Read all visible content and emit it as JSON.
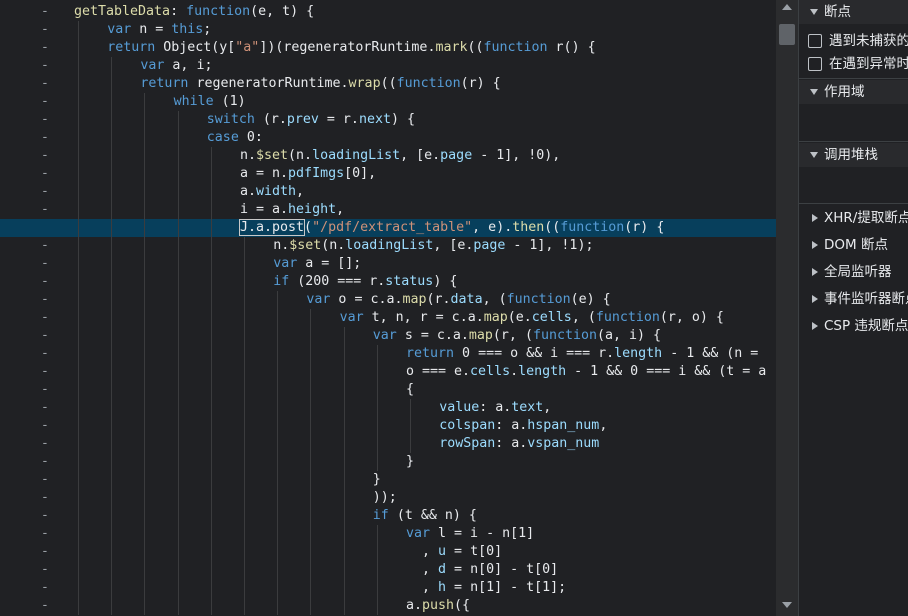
{
  "colors": {
    "background": "#202124",
    "keyword": "#569cd6",
    "function": "#dcdcaa",
    "property": "#9cdcfe",
    "string": "#ce9178",
    "number": "#b5cea8",
    "highlight_line": "#073f5c"
  },
  "editor": {
    "gutter_mark": "-",
    "highlight_index": 12,
    "lines": [
      {
        "indent": 0,
        "tokens": [
          [
            "fn",
            "getTableData"
          ],
          [
            "plain",
            ": "
          ],
          [
            "kw",
            "function"
          ],
          [
            "plain",
            "(e, t) {"
          ]
        ]
      },
      {
        "indent": 1,
        "tokens": [
          [
            "kw",
            "var"
          ],
          [
            "plain",
            " n = "
          ],
          [
            "kw",
            "this"
          ],
          [
            "plain",
            ";"
          ]
        ]
      },
      {
        "indent": 1,
        "tokens": [
          [
            "kw",
            "return"
          ],
          [
            "plain",
            " Object(y["
          ],
          [
            "str",
            "\"a\""
          ],
          [
            "plain",
            "])(regeneratorRuntime."
          ],
          [
            "fn",
            "mark"
          ],
          [
            "plain",
            "(("
          ],
          [
            "kw",
            "function"
          ],
          [
            "plain",
            " r() {"
          ]
        ]
      },
      {
        "indent": 2,
        "tokens": [
          [
            "kw",
            "var"
          ],
          [
            "plain",
            " a, i;"
          ]
        ]
      },
      {
        "indent": 2,
        "tokens": [
          [
            "kw",
            "return"
          ],
          [
            "plain",
            " regeneratorRuntime."
          ],
          [
            "fn",
            "wrap"
          ],
          [
            "plain",
            "(("
          ],
          [
            "kw",
            "function"
          ],
          [
            "plain",
            "(r) {"
          ]
        ]
      },
      {
        "indent": 3,
        "tokens": [
          [
            "kw",
            "while"
          ],
          [
            "plain",
            " (1)"
          ]
        ]
      },
      {
        "indent": 4,
        "tokens": [
          [
            "kw",
            "switch"
          ],
          [
            "plain",
            " (r."
          ],
          [
            "prop",
            "prev"
          ],
          [
            "plain",
            " = r."
          ],
          [
            "prop",
            "next"
          ],
          [
            "plain",
            ") {"
          ]
        ]
      },
      {
        "indent": 4,
        "tokens": [
          [
            "kw",
            "case"
          ],
          [
            "plain",
            " 0:"
          ]
        ]
      },
      {
        "indent": 5,
        "tokens": [
          [
            "plain",
            "n."
          ],
          [
            "fn",
            "$set"
          ],
          [
            "plain",
            "(n."
          ],
          [
            "prop",
            "loadingList"
          ],
          [
            "plain",
            ", [e."
          ],
          [
            "prop",
            "page"
          ],
          [
            "plain",
            " - 1], !0),"
          ]
        ]
      },
      {
        "indent": 5,
        "tokens": [
          [
            "plain",
            "a = n."
          ],
          [
            "prop",
            "pdfImgs"
          ],
          [
            "plain",
            "[0],"
          ]
        ]
      },
      {
        "indent": 5,
        "tokens": [
          [
            "plain",
            "a."
          ],
          [
            "prop",
            "width"
          ],
          [
            "plain",
            ","
          ]
        ]
      },
      {
        "indent": 5,
        "tokens": [
          [
            "plain",
            "i = a."
          ],
          [
            "prop",
            "height"
          ],
          [
            "plain",
            ","
          ]
        ]
      },
      {
        "indent": 5,
        "tokens": [
          [
            "box",
            "J.a.post"
          ],
          [
            "plain",
            "("
          ],
          [
            "str",
            "\"/pdf/extract_table\""
          ],
          [
            "plain",
            ", e)."
          ],
          [
            "fn",
            "then"
          ],
          [
            "plain",
            "(("
          ],
          [
            "kw",
            "function"
          ],
          [
            "plain",
            "(r) {"
          ]
        ]
      },
      {
        "indent": 6,
        "tokens": [
          [
            "plain",
            "n."
          ],
          [
            "fn",
            "$set"
          ],
          [
            "plain",
            "(n."
          ],
          [
            "prop",
            "loadingList"
          ],
          [
            "plain",
            ", [e."
          ],
          [
            "prop",
            "page"
          ],
          [
            "plain",
            " - 1], !1);"
          ]
        ]
      },
      {
        "indent": 6,
        "tokens": [
          [
            "kw",
            "var"
          ],
          [
            "plain",
            " a = [];"
          ]
        ]
      },
      {
        "indent": 6,
        "tokens": [
          [
            "kw",
            "if"
          ],
          [
            "plain",
            " (200 === r."
          ],
          [
            "prop",
            "status"
          ],
          [
            "plain",
            ") {"
          ]
        ]
      },
      {
        "indent": 7,
        "tokens": [
          [
            "kw",
            "var"
          ],
          [
            "plain",
            " o = c.a."
          ],
          [
            "fn",
            "map"
          ],
          [
            "plain",
            "(r."
          ],
          [
            "prop",
            "data"
          ],
          [
            "plain",
            ", ("
          ],
          [
            "kw",
            "function"
          ],
          [
            "plain",
            "(e) {"
          ]
        ]
      },
      {
        "indent": 8,
        "tokens": [
          [
            "kw",
            "var"
          ],
          [
            "plain",
            " t, n, r = c.a."
          ],
          [
            "fn",
            "map"
          ],
          [
            "plain",
            "(e."
          ],
          [
            "prop",
            "cells"
          ],
          [
            "plain",
            ", ("
          ],
          [
            "kw",
            "function"
          ],
          [
            "plain",
            "(r, o) {"
          ]
        ]
      },
      {
        "indent": 9,
        "tokens": [
          [
            "kw",
            "var"
          ],
          [
            "plain",
            " s = c.a."
          ],
          [
            "fn",
            "map"
          ],
          [
            "plain",
            "(r, ("
          ],
          [
            "kw",
            "function"
          ],
          [
            "plain",
            "(a, i) {"
          ]
        ]
      },
      {
        "indent": 10,
        "tokens": [
          [
            "kw",
            "return"
          ],
          [
            "plain",
            " 0 === o && i === r."
          ],
          [
            "prop",
            "length"
          ],
          [
            "plain",
            " - 1 && (n = "
          ]
        ]
      },
      {
        "indent": 10,
        "tokens": [
          [
            "plain",
            "o === e."
          ],
          [
            "prop",
            "cells"
          ],
          [
            "plain",
            "."
          ],
          [
            "prop",
            "length"
          ],
          [
            "plain",
            " - 1 && 0 === i && (t = a"
          ]
        ]
      },
      {
        "indent": 10,
        "tokens": [
          [
            "plain",
            "{"
          ]
        ]
      },
      {
        "indent": 11,
        "tokens": [
          [
            "prop",
            "value"
          ],
          [
            "plain",
            ": a."
          ],
          [
            "prop",
            "text"
          ],
          [
            "plain",
            ","
          ]
        ]
      },
      {
        "indent": 11,
        "tokens": [
          [
            "prop",
            "colspan"
          ],
          [
            "plain",
            ": a."
          ],
          [
            "prop",
            "hspan_num"
          ],
          [
            "plain",
            ","
          ]
        ]
      },
      {
        "indent": 11,
        "tokens": [
          [
            "prop",
            "rowSpan"
          ],
          [
            "plain",
            ": a."
          ],
          [
            "prop",
            "vspan_num"
          ]
        ]
      },
      {
        "indent": 10,
        "tokens": [
          [
            "plain",
            "}"
          ]
        ]
      },
      {
        "indent": 9,
        "tokens": [
          [
            "plain",
            "}"
          ]
        ]
      },
      {
        "indent": 9,
        "tokens": [
          [
            "plain",
            "));"
          ]
        ]
      },
      {
        "indent": 9,
        "tokens": [
          [
            "kw",
            "if"
          ],
          [
            "plain",
            " (t && n) {"
          ]
        ]
      },
      {
        "indent": 10,
        "tokens": [
          [
            "kw",
            "var"
          ],
          [
            "plain",
            " l = i - n[1]"
          ]
        ]
      },
      {
        "indent": 10,
        "tokens": [
          [
            "plain",
            "  , "
          ],
          [
            "prop",
            "u"
          ],
          [
            "plain",
            " = t[0]"
          ]
        ]
      },
      {
        "indent": 10,
        "tokens": [
          [
            "plain",
            "  , "
          ],
          [
            "prop",
            "d"
          ],
          [
            "plain",
            " = n[0] - t[0]"
          ]
        ]
      },
      {
        "indent": 10,
        "tokens": [
          [
            "plain",
            "  , "
          ],
          [
            "prop",
            "h"
          ],
          [
            "plain",
            " = n[1] - t[1];"
          ]
        ]
      },
      {
        "indent": 10,
        "tokens": [
          [
            "plain",
            "a."
          ],
          [
            "fn",
            "push"
          ],
          [
            "plain",
            "({"
          ]
        ]
      }
    ]
  },
  "sidebar": {
    "breakpoints": {
      "title": "断点",
      "options": [
        {
          "label": "遇到未捕获的异常时暂停",
          "checked": false
        },
        {
          "label": "在遇到异常时暂停",
          "checked": false
        }
      ]
    },
    "scope": {
      "title": "作用域"
    },
    "call_stack": {
      "title": "调用堆栈"
    },
    "collapsed_sections": [
      "XHR/提取断点",
      "DOM 断点",
      "全局监听器",
      "事件监听器断点",
      "CSP 违规断点"
    ]
  }
}
